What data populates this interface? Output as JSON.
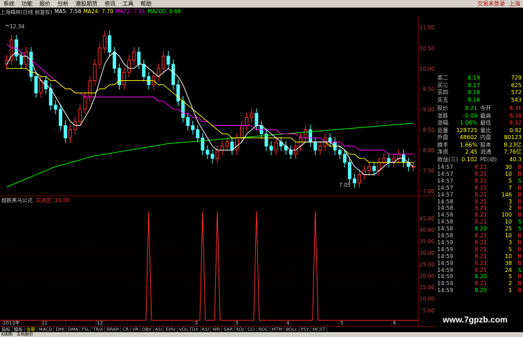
{
  "menu": [
    "系统",
    "功能",
    "报价",
    "分析",
    "港股期货",
    "资讯",
    "工具",
    "帮助"
  ],
  "menu_right": {
    "trade": "交易未登录",
    "exchange": "上海"
  },
  "info": {
    "title": "上海梅林(日线 前复权)",
    "ma5_label": "MA5:",
    "ma5": "7.58",
    "ma24_label": "MA24:",
    "ma24": "7.70",
    "ma72_label": "MA72:",
    "ma72": "7.91",
    "ma200_label": "MA200:",
    "ma200": "8.68",
    "colors": {
      "ma5": "#ffffff",
      "ma24": "#ffff00",
      "ma72": "#ff00ff",
      "ma200": "#00ff00"
    }
  },
  "indicator_label": "超跌黑马公式",
  "indicator_value": "买进区: 20.00",
  "chart_data": {
    "type": "candlestick",
    "price_axis": {
      "ticks": [
        "11.00",
        "10.50",
        "10.00",
        "9.50",
        "9.00",
        "8.50",
        "8.00",
        "7.50",
        "7.00"
      ],
      "ylim": [
        6.9,
        11.3
      ]
    },
    "indicator_axis": {
      "ticks": [
        "45.00",
        "40.00",
        "35.00",
        "30.00",
        "25.00",
        "20.00",
        "15.00",
        "10.00",
        "5.00"
      ],
      "ylim": [
        0,
        52
      ]
    },
    "annotations": {
      "high": "12.34",
      "low": "7.05"
    },
    "x_labels": [
      "2013年",
      "11",
      "12",
      "2",
      "3",
      "4",
      "5",
      "6"
    ],
    "closes": [
      10.2,
      10.7,
      10.3,
      10.1,
      10.4,
      9.8,
      9.4,
      9.7,
      9.5,
      9.1,
      9.0,
      8.6,
      8.3,
      8.5,
      8.7,
      9.0,
      9.3,
      9.7,
      10.1,
      10.5,
      10.8,
      10.4,
      10.0,
      9.6,
      9.9,
      10.2,
      10.4,
      10.1,
      9.8,
      9.6,
      9.8,
      10.0,
      10.3,
      10.1,
      9.6,
      9.2,
      8.8,
      8.6,
      8.5,
      8.3,
      8.0,
      7.9,
      7.8,
      8.0,
      8.1,
      8.2,
      8.0,
      8.3,
      8.6,
      8.8,
      8.9,
      8.6,
      8.4,
      8.1,
      8.0,
      8.2,
      8.1,
      8.0,
      7.9,
      8.1,
      8.3,
      8.5,
      8.2,
      8.0,
      8.1,
      8.3,
      8.2,
      8.0,
      7.9,
      7.7,
      7.3,
      7.2,
      7.4,
      7.5,
      7.6,
      7.5,
      7.7,
      7.8,
      7.7,
      7.8,
      7.9,
      7.7,
      7.6,
      7.6
    ],
    "ma5": [
      10.1,
      10.3,
      10.4,
      10.3,
      10.3,
      10.2,
      9.9,
      9.7,
      9.6,
      9.5,
      9.3,
      9.1,
      8.9,
      8.7,
      8.6,
      8.6,
      8.8,
      9.0,
      9.3,
      9.7,
      10.1,
      10.3,
      10.4,
      10.3,
      10.1,
      10.0,
      10.0,
      10.1,
      10.1,
      10.0,
      9.9,
      9.8,
      9.9,
      10.0,
      9.9,
      9.8,
      9.6,
      9.3,
      9.0,
      8.7,
      8.5,
      8.3,
      8.1,
      8.0,
      8.0,
      8.0,
      8.0,
      8.1,
      8.2,
      8.4,
      8.5,
      8.6,
      8.6,
      8.5,
      8.4,
      8.3,
      8.2,
      8.1,
      8.0,
      8.0,
      8.1,
      8.2,
      8.2,
      8.2,
      8.2,
      8.2,
      8.2,
      8.1,
      8.1,
      8.0,
      7.8,
      7.6,
      7.5,
      7.4,
      7.4,
      7.4,
      7.5,
      7.6,
      7.7,
      7.7,
      7.8,
      7.8,
      7.7,
      7.6
    ],
    "ma24": [
      10.0,
      10.0,
      10.0,
      10.0,
      10.0,
      9.9,
      9.9,
      9.8,
      9.8,
      9.7,
      9.7,
      9.6,
      9.5,
      9.5,
      9.4,
      9.4,
      9.4,
      9.4,
      9.4,
      9.5,
      9.5,
      9.6,
      9.6,
      9.7,
      9.7,
      9.7,
      9.7,
      9.7,
      9.7,
      9.7,
      9.7,
      9.6,
      9.6,
      9.5,
      9.4,
      9.3,
      9.2,
      9.1,
      9.0,
      8.9,
      8.8,
      8.7,
      8.6,
      8.5,
      8.4,
      8.4,
      8.3,
      8.3,
      8.3,
      8.3,
      8.3,
      8.3,
      8.3,
      8.3,
      8.3,
      8.3,
      8.3,
      8.3,
      8.3,
      8.2,
      8.2,
      8.2,
      8.2,
      8.2,
      8.2,
      8.2,
      8.1,
      8.1,
      8.1,
      8.0,
      7.9,
      7.9,
      7.8,
      7.8,
      7.7,
      7.7,
      7.7,
      7.7,
      7.7,
      7.7,
      7.7,
      7.7,
      7.7,
      7.7
    ],
    "ma72": [
      10.6,
      10.5,
      10.5,
      10.4,
      10.3,
      10.2,
      10.1,
      10.0,
      9.9,
      9.8,
      9.7,
      9.6,
      9.5,
      9.5,
      9.4,
      9.4,
      9.3,
      9.3,
      9.3,
      9.3,
      9.3,
      9.3,
      9.3,
      9.3,
      9.3,
      9.3,
      9.3,
      9.3,
      9.3,
      9.3,
      9.3,
      9.2,
      9.2,
      9.1,
      9.0,
      9.0,
      8.9,
      8.9,
      8.8,
      8.8,
      8.7,
      8.7,
      8.6,
      8.6,
      8.6,
      8.6,
      8.6,
      8.6,
      8.6,
      8.6,
      8.6,
      8.5,
      8.5,
      8.5,
      8.5,
      8.5,
      8.4,
      8.4,
      8.4,
      8.4,
      8.3,
      8.3,
      8.3,
      8.3,
      8.3,
      8.2,
      8.2,
      8.2,
      8.2,
      8.1,
      8.1,
      8.1,
      8.0,
      8.0,
      8.0,
      8.0,
      8.0,
      8.0,
      7.9,
      7.9,
      7.9,
      7.9,
      7.9,
      7.9
    ],
    "ma200": [
      7.1,
      7.15,
      7.2,
      7.25,
      7.3,
      7.35,
      7.4,
      7.45,
      7.5,
      7.55,
      7.6,
      7.63,
      7.66,
      7.7,
      7.73,
      7.76,
      7.8,
      7.83,
      7.86,
      7.88,
      7.9,
      7.92,
      7.94,
      7.96,
      7.98,
      8.0,
      8.02,
      8.04,
      8.06,
      8.08,
      8.1,
      8.12,
      8.14,
      8.16,
      8.17,
      8.18,
      8.19,
      8.2,
      8.21,
      8.22,
      8.23,
      8.24,
      8.25,
      8.26,
      8.27,
      8.28,
      8.29,
      8.3,
      8.31,
      8.32,
      8.33,
      8.34,
      8.35,
      8.36,
      8.37,
      8.38,
      8.39,
      8.4,
      8.41,
      8.42,
      8.43,
      8.44,
      8.45,
      8.46,
      8.47,
      8.48,
      8.49,
      8.5,
      8.51,
      8.52,
      8.53,
      8.54,
      8.55,
      8.56,
      8.57,
      8.58,
      8.59,
      8.6,
      8.61,
      8.62,
      8.63,
      8.64,
      8.65,
      8.66
    ],
    "signal_spikes_at_index": [
      29,
      40,
      43,
      51,
      63
    ]
  },
  "quotes": {
    "asks": [
      {
        "label": "卖二",
        "price": "8.19",
        "vol": "729"
      },
      {
        "label": "买三",
        "price": "8.17",
        "vol": "625"
      },
      {
        "label": "买四",
        "price": "8.18",
        "vol": "572"
      },
      {
        "label": "买五",
        "price": "8.16",
        "vol": "543"
      }
    ],
    "stats": [
      {
        "l1": "现价",
        "v1": "8.21",
        "l2": "今开",
        "v2": "8.31"
      },
      {
        "l1": "涨跌",
        "v1": "-0.09",
        "l2": "最高",
        "v2": "8.38"
      },
      {
        "l1": "涨幅",
        "v1": "-1.08%",
        "l2": "最低",
        "v2": "8.12"
      },
      {
        "l1": "总量",
        "v1": "128725",
        "l2": "量比",
        "v2": "0.92"
      },
      {
        "l1": "外盘",
        "v1": "48602",
        "l2": "内盘",
        "v2": "80123"
      },
      {
        "l1": "换手",
        "v1": "1.66%",
        "l2": "股本",
        "v2": "8.23亿"
      },
      {
        "l1": "净资",
        "v1": "2.45",
        "l2": "流通",
        "v2": "7.76亿"
      },
      {
        "l1": "收益(三)",
        "v1": "0.102",
        "l2": "PE(动)",
        "v2": "40.3"
      }
    ],
    "ticks": [
      {
        "t": "14:57",
        "p": "8.21",
        "v": "30",
        "s": "B"
      },
      {
        "t": "14:57",
        "p": "8.21",
        "v": "10",
        "s": "B"
      },
      {
        "t": "14:57",
        "p": "8.21",
        "v": "5",
        "s": "S"
      },
      {
        "t": "14:57",
        "p": "8.21",
        "v": "7",
        "s": "B"
      },
      {
        "t": "14:57",
        "p": "8.21",
        "v": "146",
        "s": "B"
      },
      {
        "t": "14:58",
        "p": "8.21",
        "v": "3",
        "s": "B"
      },
      {
        "t": "14:58",
        "p": "8.21",
        "v": "2",
        "s": "B"
      },
      {
        "t": "14:58",
        "p": "8.21",
        "v": "100",
        "s": "B"
      },
      {
        "t": "14:58",
        "p": "8.21",
        "v": "10",
        "s": "S"
      },
      {
        "t": "14:58",
        "p": "8.20",
        "v": "25",
        "s": "S"
      },
      {
        "t": "14:58",
        "p": "8.21",
        "v": "10",
        "s": "B"
      },
      {
        "t": "14:59",
        "p": "8.21",
        "v": "3",
        "s": "B"
      },
      {
        "t": "14:59",
        "p": "8.21",
        "v": "5",
        "s": "B"
      },
      {
        "t": "14:59",
        "p": "8.21",
        "v": "10",
        "s": "B"
      },
      {
        "t": "14:59",
        "p": "8.21",
        "v": "38",
        "s": "B"
      },
      {
        "t": "14:59",
        "p": "8.21",
        "v": "24",
        "s": "S"
      },
      {
        "t": "14:59",
        "p": "8.20",
        "v": "5",
        "s": "B"
      },
      {
        "t": "14:59",
        "p": "8.21",
        "v": "2",
        "s": "B"
      },
      {
        "t": "14:59",
        "p": "8.20",
        "v": "1",
        "s": "B"
      }
    ]
  },
  "tabs": [
    "指标",
    "模板",
    "全部",
    "MACD",
    "DMI",
    "DMA",
    "FSL",
    "TRIX",
    "BRAR",
    "CR",
    "VR",
    "OBV",
    "ASI",
    "EMV",
    "VOL-TDX",
    "RSI",
    "WR",
    "SAR",
    "KDJ",
    "CCI",
    "ROC",
    "MTM",
    "BOLL",
    "PSY",
    "MCST"
  ],
  "active_tab": "全部",
  "bottom": [
    "K线图",
    "五档报价"
  ],
  "watermark": "www.7gpzb.com"
}
